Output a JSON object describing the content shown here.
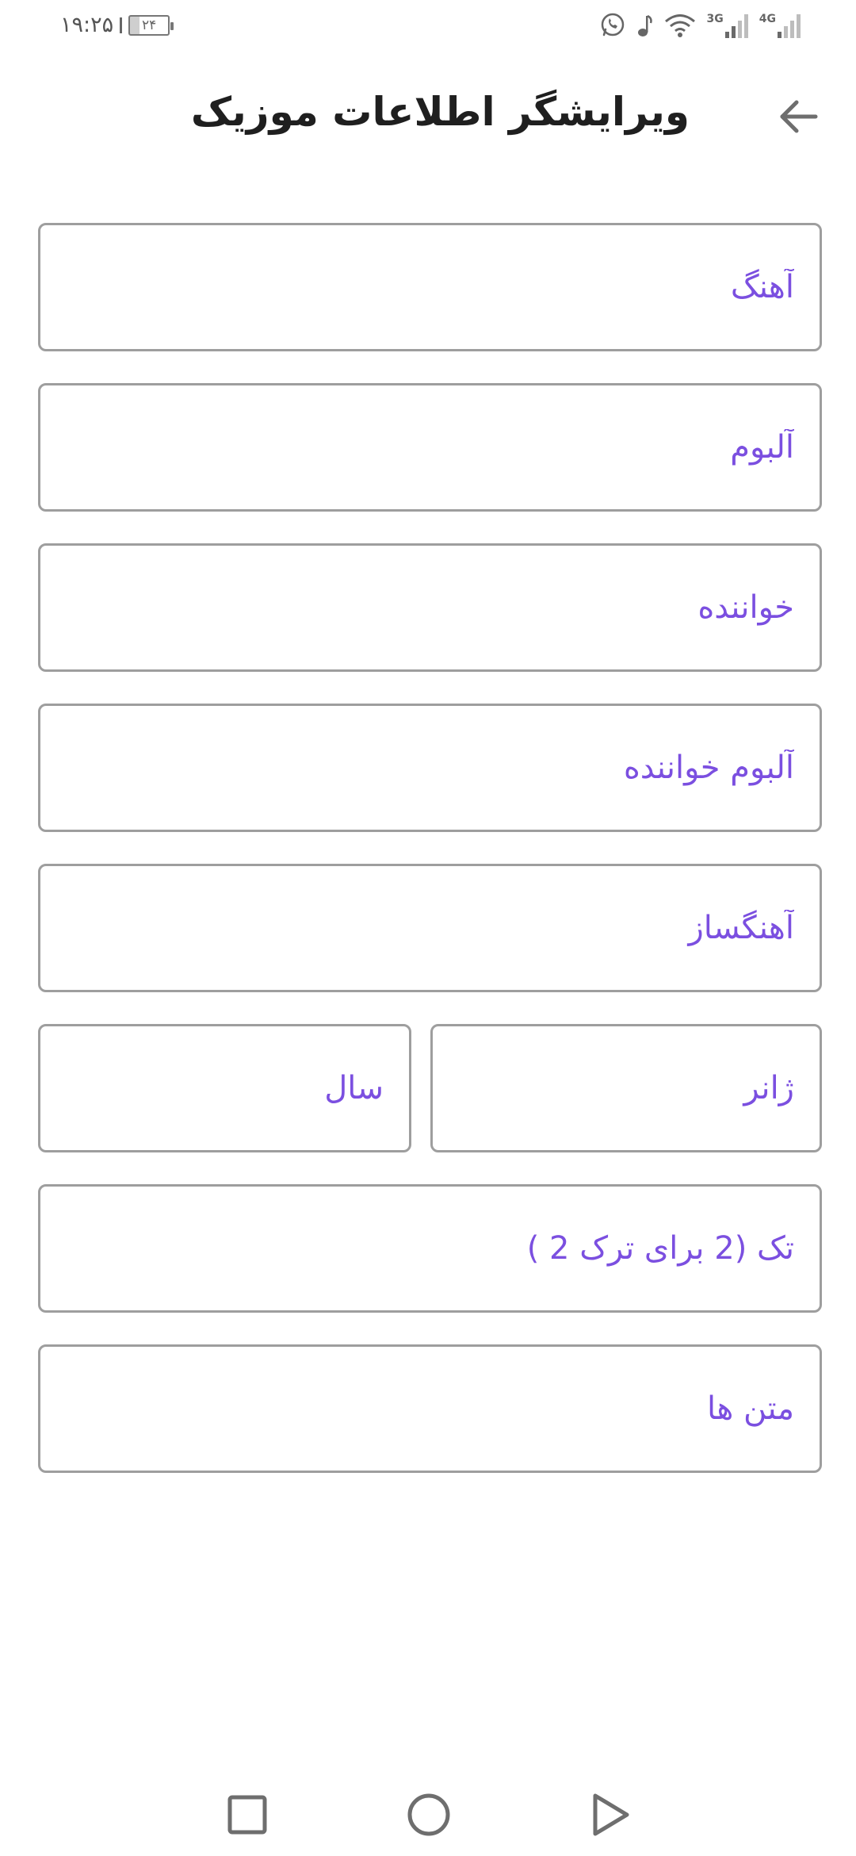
{
  "status_bar": {
    "time": "۱۹:۲۵",
    "battery_text": "۲۴",
    "battery_level": 0.24,
    "network_3g": "3G",
    "network_4g": "4G",
    "icons": [
      "whatsapp-icon",
      "music-note-icon",
      "wifi-icon",
      "signal-3g-icon",
      "signal-4g-icon"
    ]
  },
  "header": {
    "title": "ویرایشگر اطلاعات موزیک",
    "back_icon": "arrow-left-icon"
  },
  "fields": {
    "song": {
      "placeholder": "آهنگ",
      "value": ""
    },
    "album": {
      "placeholder": "آلبوم",
      "value": ""
    },
    "artist": {
      "placeholder": "خواننده",
      "value": ""
    },
    "album_artist": {
      "placeholder": "آلبوم خواننده",
      "value": ""
    },
    "composer": {
      "placeholder": "آهنگساز",
      "value": ""
    },
    "genre": {
      "placeholder": "ژانر",
      "value": ""
    },
    "year": {
      "placeholder": "سال",
      "value": ""
    },
    "track": {
      "placeholder": "تک (2 برای ترک 2 )",
      "value": ""
    },
    "lyrics": {
      "placeholder": "متن ها",
      "value": ""
    }
  },
  "colors": {
    "accent": "#7b4fe0",
    "border": "#9e9e9e",
    "title": "#1f1f1f"
  },
  "nav_bar": {
    "icons": [
      "recents-square-icon",
      "home-circle-icon",
      "back-triangle-icon"
    ]
  }
}
